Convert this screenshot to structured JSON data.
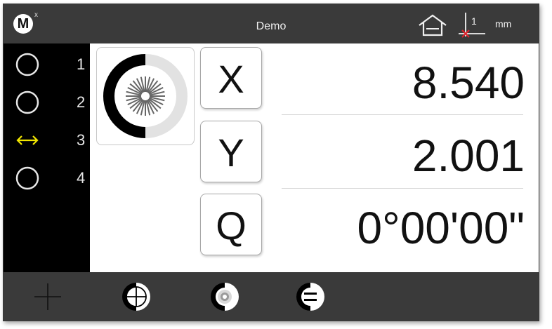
{
  "titlebar": {
    "logo_letter": "M",
    "logo_badge": "x",
    "title": "Demo",
    "home_icon": "home-icon",
    "origin_icon": "origin-marker-icon",
    "origin_label": "1",
    "units": "mm"
  },
  "sidebar": {
    "slots": [
      {
        "icon": "circle-icon",
        "number": "1"
      },
      {
        "icon": "circle-icon",
        "number": "2"
      },
      {
        "icon": "double-arrow-icon",
        "number": "3",
        "color": "#f2e600"
      },
      {
        "icon": "circle-icon",
        "number": "4"
      }
    ]
  },
  "status": {
    "icon": "probe-target-icon"
  },
  "axes": [
    {
      "label": "X",
      "value": "8.540"
    },
    {
      "label": "Y",
      "value": "2.001"
    },
    {
      "label": "Q",
      "value": "0°00'00\""
    }
  ],
  "toolbar": {
    "tools": [
      {
        "icon": "crosshair-icon"
      },
      {
        "icon": "half-circle-crosshair-icon"
      },
      {
        "icon": "half-circle-target-icon"
      },
      {
        "icon": "half-circle-equals-icon"
      }
    ]
  }
}
